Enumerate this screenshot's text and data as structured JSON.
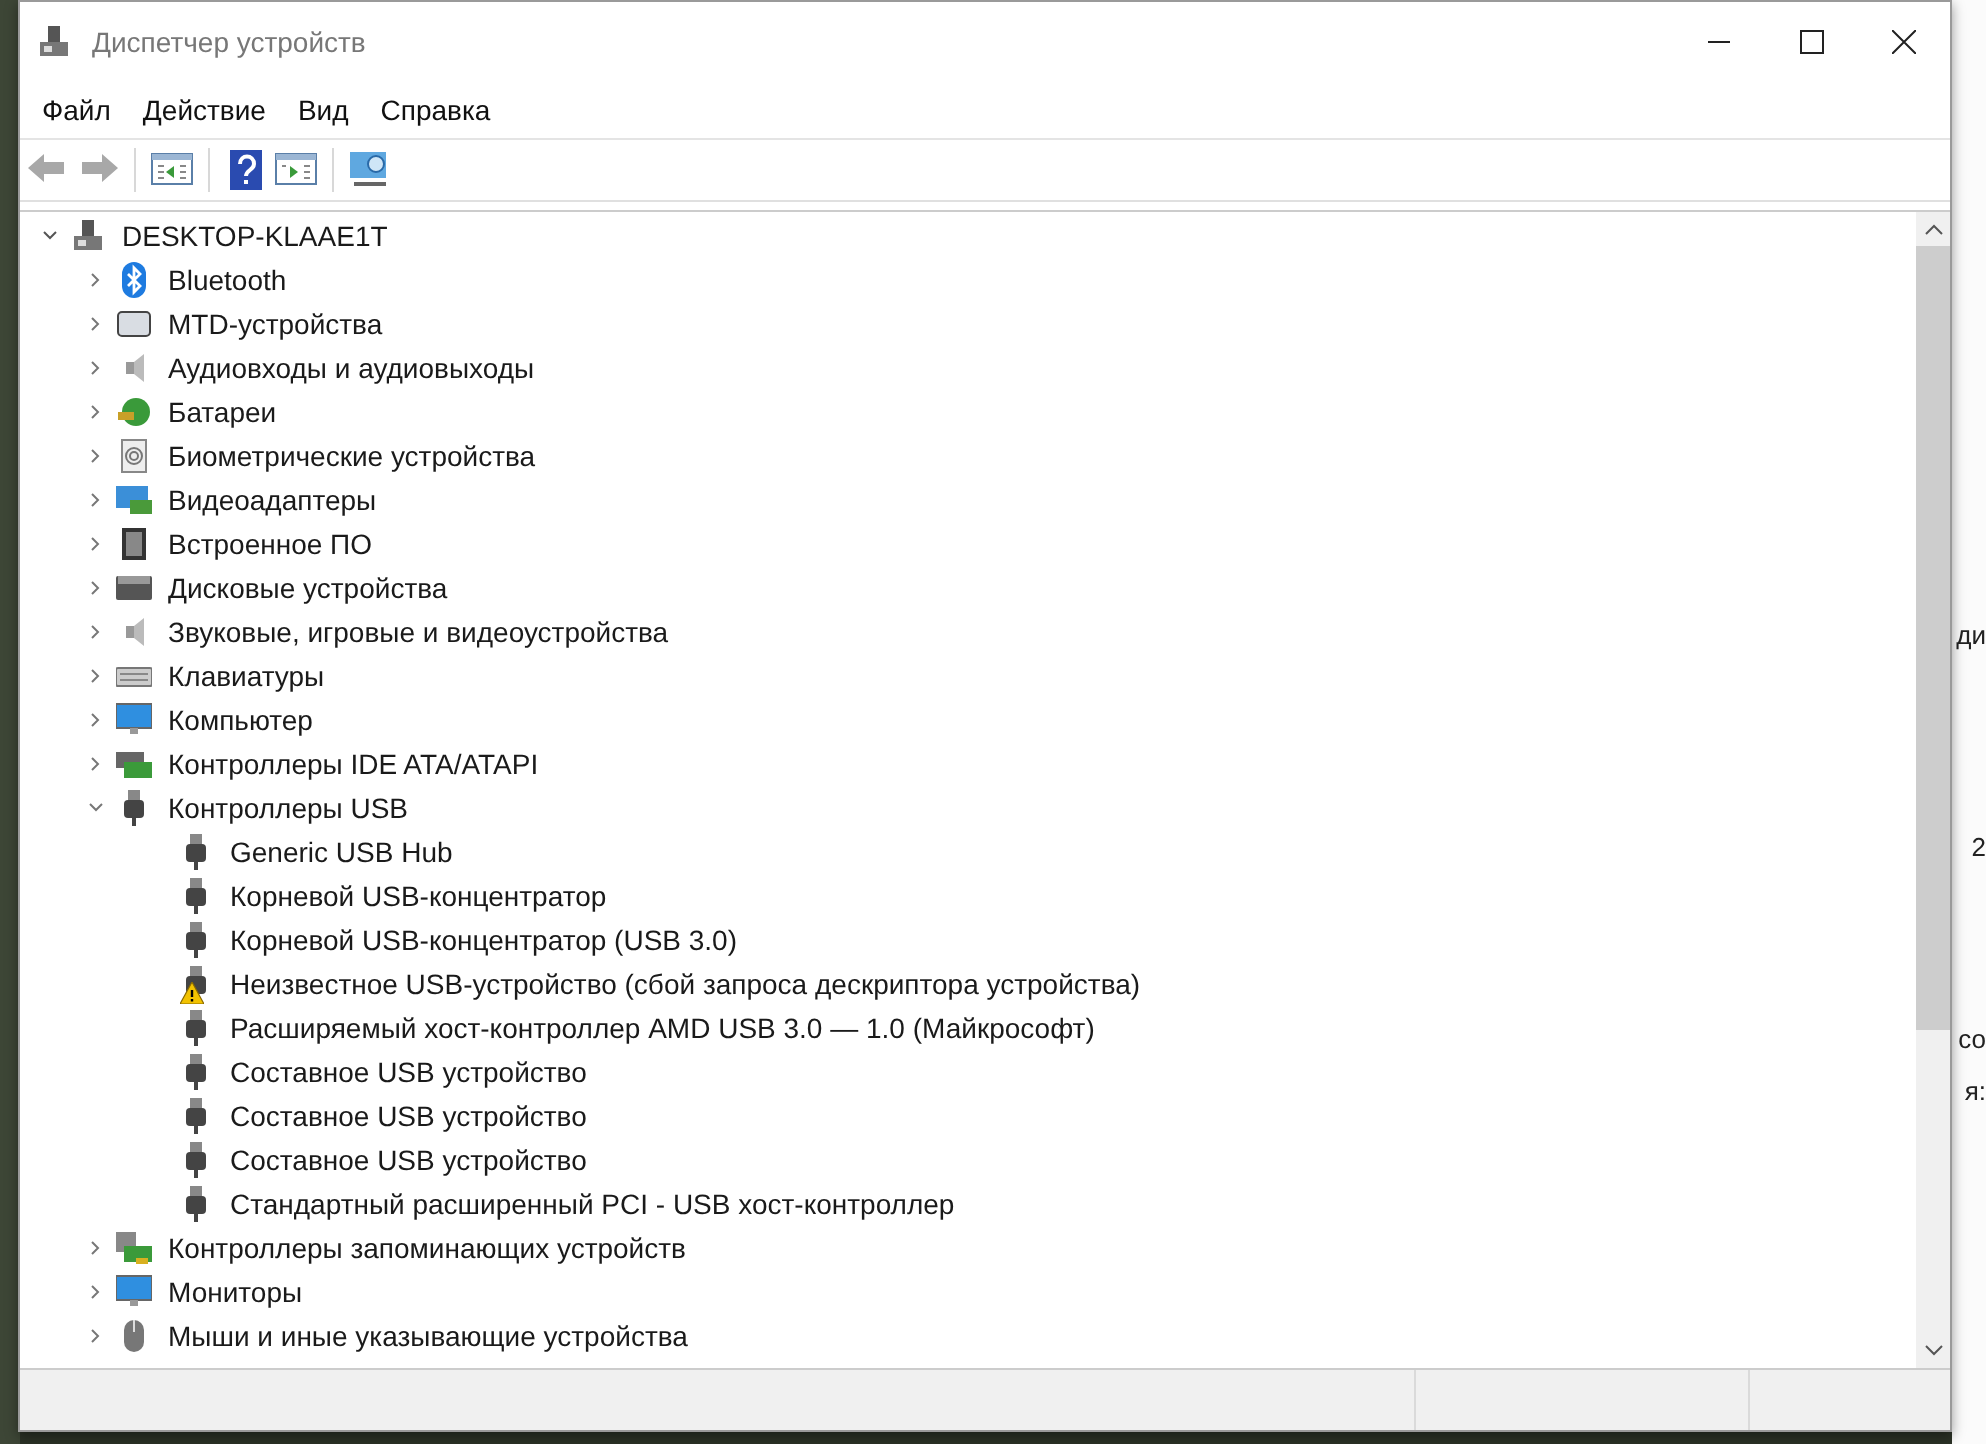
{
  "window": {
    "title": "Диспетчер устройств"
  },
  "menu": [
    "Файл",
    "Действие",
    "Вид",
    "Справка"
  ],
  "toolbar": [
    {
      "kind": "back",
      "disabled": true
    },
    {
      "kind": "forward",
      "disabled": true
    },
    {
      "kind": "panel-left"
    },
    {
      "kind": "help"
    },
    {
      "kind": "panel-right"
    },
    {
      "kind": "scan"
    }
  ],
  "tree": {
    "label": "DESKTOP-KLAAE1T",
    "kind": "pc",
    "expanded": true,
    "children": [
      {
        "label": "Bluetooth",
        "kind": "bluetooth",
        "expanded": false
      },
      {
        "label": "MTD-устройства",
        "kind": "mtd",
        "expanded": false
      },
      {
        "label": "Аудиовходы и аудиовыходы",
        "kind": "speaker",
        "expanded": false
      },
      {
        "label": "Батареи",
        "kind": "battery",
        "expanded": false
      },
      {
        "label": "Биометрические устройства",
        "kind": "fingerprint",
        "expanded": false
      },
      {
        "label": "Видеоадаптеры",
        "kind": "display",
        "expanded": false
      },
      {
        "label": "Встроенное ПО",
        "kind": "chip",
        "expanded": false
      },
      {
        "label": "Дисковые устройства",
        "kind": "disk",
        "expanded": false
      },
      {
        "label": "Звуковые, игровые и видеоустройства",
        "kind": "speaker",
        "expanded": false
      },
      {
        "label": "Клавиатуры",
        "kind": "keyboard",
        "expanded": false
      },
      {
        "label": "Компьютер",
        "kind": "monitor",
        "expanded": false
      },
      {
        "label": "Контроллеры IDE ATA/ATAPI",
        "kind": "board",
        "expanded": false
      },
      {
        "label": "Контроллеры USB",
        "kind": "usb",
        "expanded": true,
        "children": [
          {
            "label": "Generic USB Hub",
            "kind": "usb",
            "warning": false
          },
          {
            "label": "Корневой USB-концентратор",
            "kind": "usb",
            "warning": false
          },
          {
            "label": "Корневой USB-концентратор (USB 3.0)",
            "kind": "usb",
            "warning": false
          },
          {
            "label": "Неизвестное USB-устройство (сбой запроса дескриптора устройства)",
            "kind": "usb",
            "warning": true
          },
          {
            "label": "Расширяемый хост-контроллер AMD USB 3.0 — 1.0 (Майкрософт)",
            "kind": "usb",
            "warning": false
          },
          {
            "label": "Составное USB устройство",
            "kind": "usb",
            "warning": false
          },
          {
            "label": "Составное USB устройство",
            "kind": "usb",
            "warning": false
          },
          {
            "label": "Составное USB устройство",
            "kind": "usb",
            "warning": false
          },
          {
            "label": "Стандартный расширенный PCI - USB хост-контроллер",
            "kind": "usb",
            "warning": false
          }
        ]
      },
      {
        "label": "Контроллеры запоминающих устройств",
        "kind": "storage",
        "expanded": false
      },
      {
        "label": "Мониторы",
        "kind": "monitor",
        "expanded": false
      },
      {
        "label": "Мыши и иные указывающие устройства",
        "kind": "mouse",
        "expanded": false
      }
    ]
  },
  "desktop_fragments": [
    "ди",
    "2",
    "со",
    "я:"
  ]
}
